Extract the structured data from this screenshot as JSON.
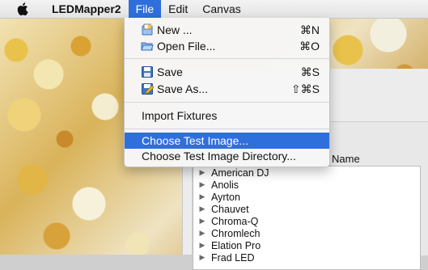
{
  "menubar": {
    "apple_icon": "apple-icon",
    "app_name": "LEDMapper2",
    "items": [
      "File",
      "Edit",
      "Canvas"
    ]
  },
  "file_menu": {
    "new": {
      "label": "New ...",
      "shortcut": "⌘N",
      "icon": "new-document-icon"
    },
    "open": {
      "label": "Open File...",
      "shortcut": "⌘O",
      "icon": "open-folder-icon"
    },
    "save": {
      "label": "Save",
      "shortcut": "⌘S",
      "icon": "save-disk-icon"
    },
    "save_as": {
      "label": "Save As...",
      "shortcut": "⇧⌘S",
      "icon": "save-as-icon"
    },
    "import": {
      "label": "Import Fixtures"
    },
    "choose_image": {
      "label": "Choose Test Image..."
    },
    "choose_dir": {
      "label": "Choose Test Image Directory..."
    }
  },
  "window": {
    "panel_title": "ry",
    "tree_header": "Name",
    "tree_items": [
      "American DJ",
      "Anolis",
      "Ayrton",
      "Chauvet",
      "Chroma-Q",
      "Chromlech",
      "Elation Pro",
      "Frad LED"
    ]
  },
  "colors": {
    "highlight": "#2f6fdc"
  }
}
